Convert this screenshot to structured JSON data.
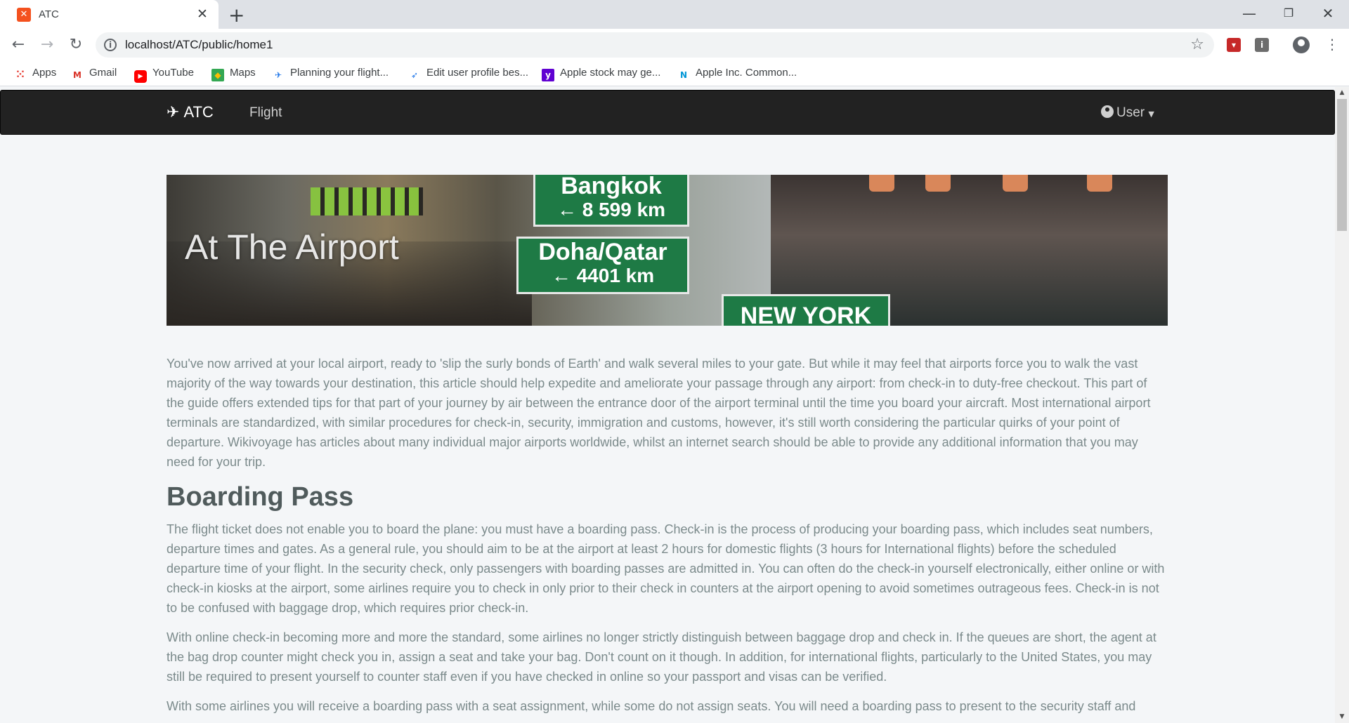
{
  "browser": {
    "tab_title": "ATC",
    "tab_favicon": "xampp-icon",
    "url": "localhost/ATC/public/home1",
    "bookmarks": [
      {
        "label": "Apps",
        "icon": "apps-grid-icon"
      },
      {
        "label": "Gmail",
        "icon": "gmail-icon"
      },
      {
        "label": "YouTube",
        "icon": "youtube-icon"
      },
      {
        "label": "Maps",
        "icon": "maps-icon"
      },
      {
        "label": "Planning your flight...",
        "icon": "flight-planning-icon"
      },
      {
        "label": "Edit user profile bes...",
        "icon": "paper-plane-icon"
      },
      {
        "label": "Apple stock may ge...",
        "icon": "yahoo-icon"
      },
      {
        "label": "Apple Inc. Common...",
        "icon": "nasdaq-icon"
      }
    ]
  },
  "navbar": {
    "brand": "ATC",
    "brand_icon": "plane-departure-icon",
    "flight": "Flight",
    "user": "User"
  },
  "hero": {
    "title": "At The Airport",
    "signs": [
      {
        "line1": "Bangkok",
        "line2": "← 8 599 km"
      },
      {
        "line1": "Doha/Qatar",
        "line2": "← 4401 km"
      },
      {
        "line1": "NEW YORK"
      }
    ]
  },
  "content": {
    "intro": "You've now arrived at your local airport, ready to 'slip the surly bonds of Earth' and walk several miles to your gate. But while it may feel that airports force you to walk the vast majority of the way towards your destination, this article should help expedite and ameliorate your passage through any airport: from check-in to duty-free checkout. This part of the guide offers extended tips for that part of your journey by air between the entrance door of the airport terminal until the time you board your aircraft. Most international airport terminals are standardized, with similar procedures for check-in, security, immigration and customs, however, it's still worth considering the particular quirks of your point of departure. Wikivoyage has articles about many individual major airports worldwide, whilst an internet search should be able to provide any additional information that you may need for your trip.",
    "heading": "Boarding Pass",
    "p1": "The flight ticket does not enable you to board the plane: you must have a boarding pass. Check-in is the process of producing your boarding pass, which includes seat numbers, departure times and gates. As a general rule, you should aim to be at the airport at least 2 hours for domestic flights (3 hours for International flights) before the scheduled departure time of your flight. In the security check, only passengers with boarding passes are admitted in. You can often do the check-in yourself electronically, either online or with check-in kiosks at the airport, some airlines require you to check in only prior to their check in counters at the airport opening to avoid sometimes outrageous fees. Check-in is not to be confused with baggage drop, which requires prior check-in.",
    "p2": "With online check-in becoming more and more the standard, some airlines no longer strictly distinguish between baggage drop and check in. If the queues are short, the agent at the bag drop counter might check you in, assign a seat and take your bag. Don't count on it though. In addition, for international flights, particularly to the United States, you may still be required to present yourself to counter staff even if you have checked in online so your passport and visas can be verified.",
    "p3": "With some airlines you will receive a boarding pass with a seat assignment, while some do not assign seats. You will need a boarding pass to present to the security staff and"
  }
}
